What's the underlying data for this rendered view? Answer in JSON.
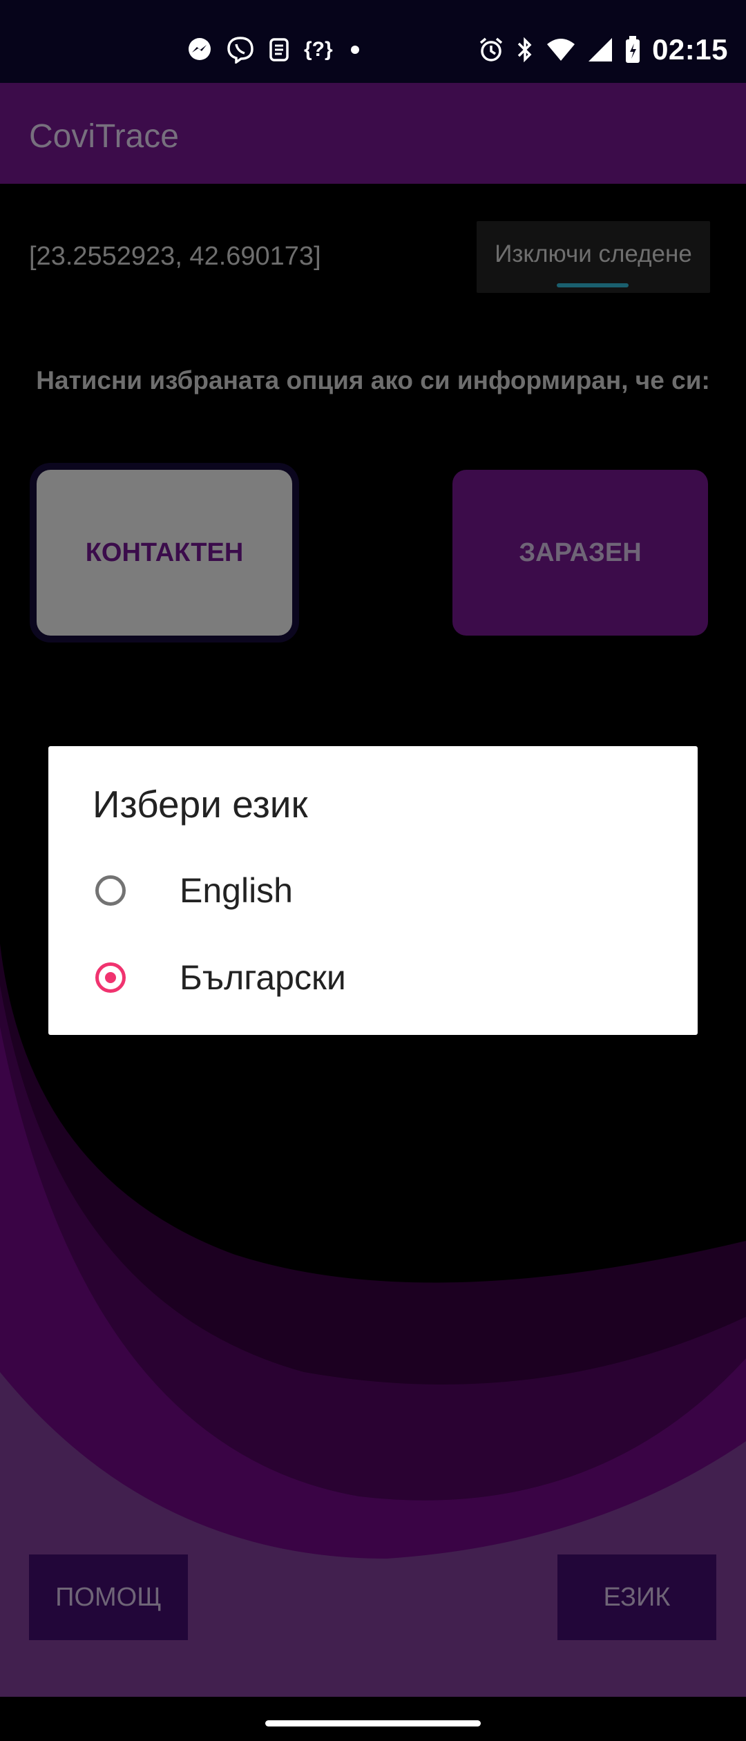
{
  "status_bar": {
    "time": "02:15",
    "icons_left": [
      "messenger-icon",
      "viber-icon",
      "notification-app-icon",
      "code-icon",
      "dot-icon"
    ],
    "icons_right": [
      "alarm-icon",
      "bluetooth-icon",
      "wifi-icon",
      "signal-icon",
      "battery-charging-icon"
    ]
  },
  "app_bar": {
    "title": "CoviTrace"
  },
  "main": {
    "coordinates": "[23.2552923, 42.690173]",
    "toggle_label": "Изключи следене",
    "prompt": "Натисни избраната опция ако си информиран, че си:",
    "contact_label": "КОНТАКТЕН",
    "infected_label": "ЗАРАЗЕН",
    "help_label": "ПОМОЩ",
    "language_label": "ЕЗИК"
  },
  "dialog": {
    "title": "Избери език",
    "options": [
      {
        "label": "English",
        "selected": false
      },
      {
        "label": "Български",
        "selected": true
      }
    ]
  },
  "colors": {
    "accent": "#f0336f",
    "primary": "#3c0c4a",
    "status_bar": "#06041a"
  }
}
